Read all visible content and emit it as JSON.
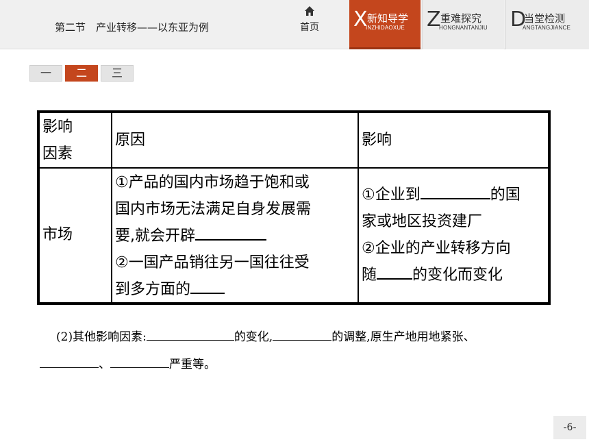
{
  "header": {
    "lesson_title": "第二节　产业转移——以东亚为例",
    "home_label": "首页",
    "tabs": [
      {
        "letter": "X",
        "label": "新知导学",
        "pinyin": "INZHIDAOXUE"
      },
      {
        "letter": "Z",
        "label": "重难探究",
        "pinyin": "HONGNANTANJIU"
      },
      {
        "letter": "D",
        "label": "当堂检测",
        "pinyin": "ANGTANGJIANCE"
      }
    ]
  },
  "pager": {
    "buttons": [
      "一",
      "二",
      "三"
    ],
    "active": 1
  },
  "table": {
    "headers": [
      "影响因素",
      "原因",
      "影响"
    ],
    "header_factor_lines": [
      "影响",
      "因素"
    ],
    "row": {
      "factor": "市场",
      "reason_lines": [
        "①产品的国内市场趋于饱和或",
        "国内市场无法满足自身发展需",
        "要,就会开辟",
        "②一国产品销往另一国往往受",
        "到多方面的"
      ],
      "impact_parts": {
        "l1_pre": "①企业到",
        "l1_post": "的国",
        "l2": "家或地区投资建厂",
        "l3": "②企业的产业转移方向",
        "l4_pre": "随",
        "l4_post": "的变化而变化"
      }
    }
  },
  "paragraph": {
    "prefix": "(2)其他影响因素:",
    "seg1": "的变化,",
    "seg2": "的调整,原生产地用地紧张、",
    "seg3": "、",
    "seg4": "严重等。"
  },
  "page_number": "-6-",
  "colors": {
    "accent": "#c4461d",
    "header_bg": "#f0f0f0"
  }
}
